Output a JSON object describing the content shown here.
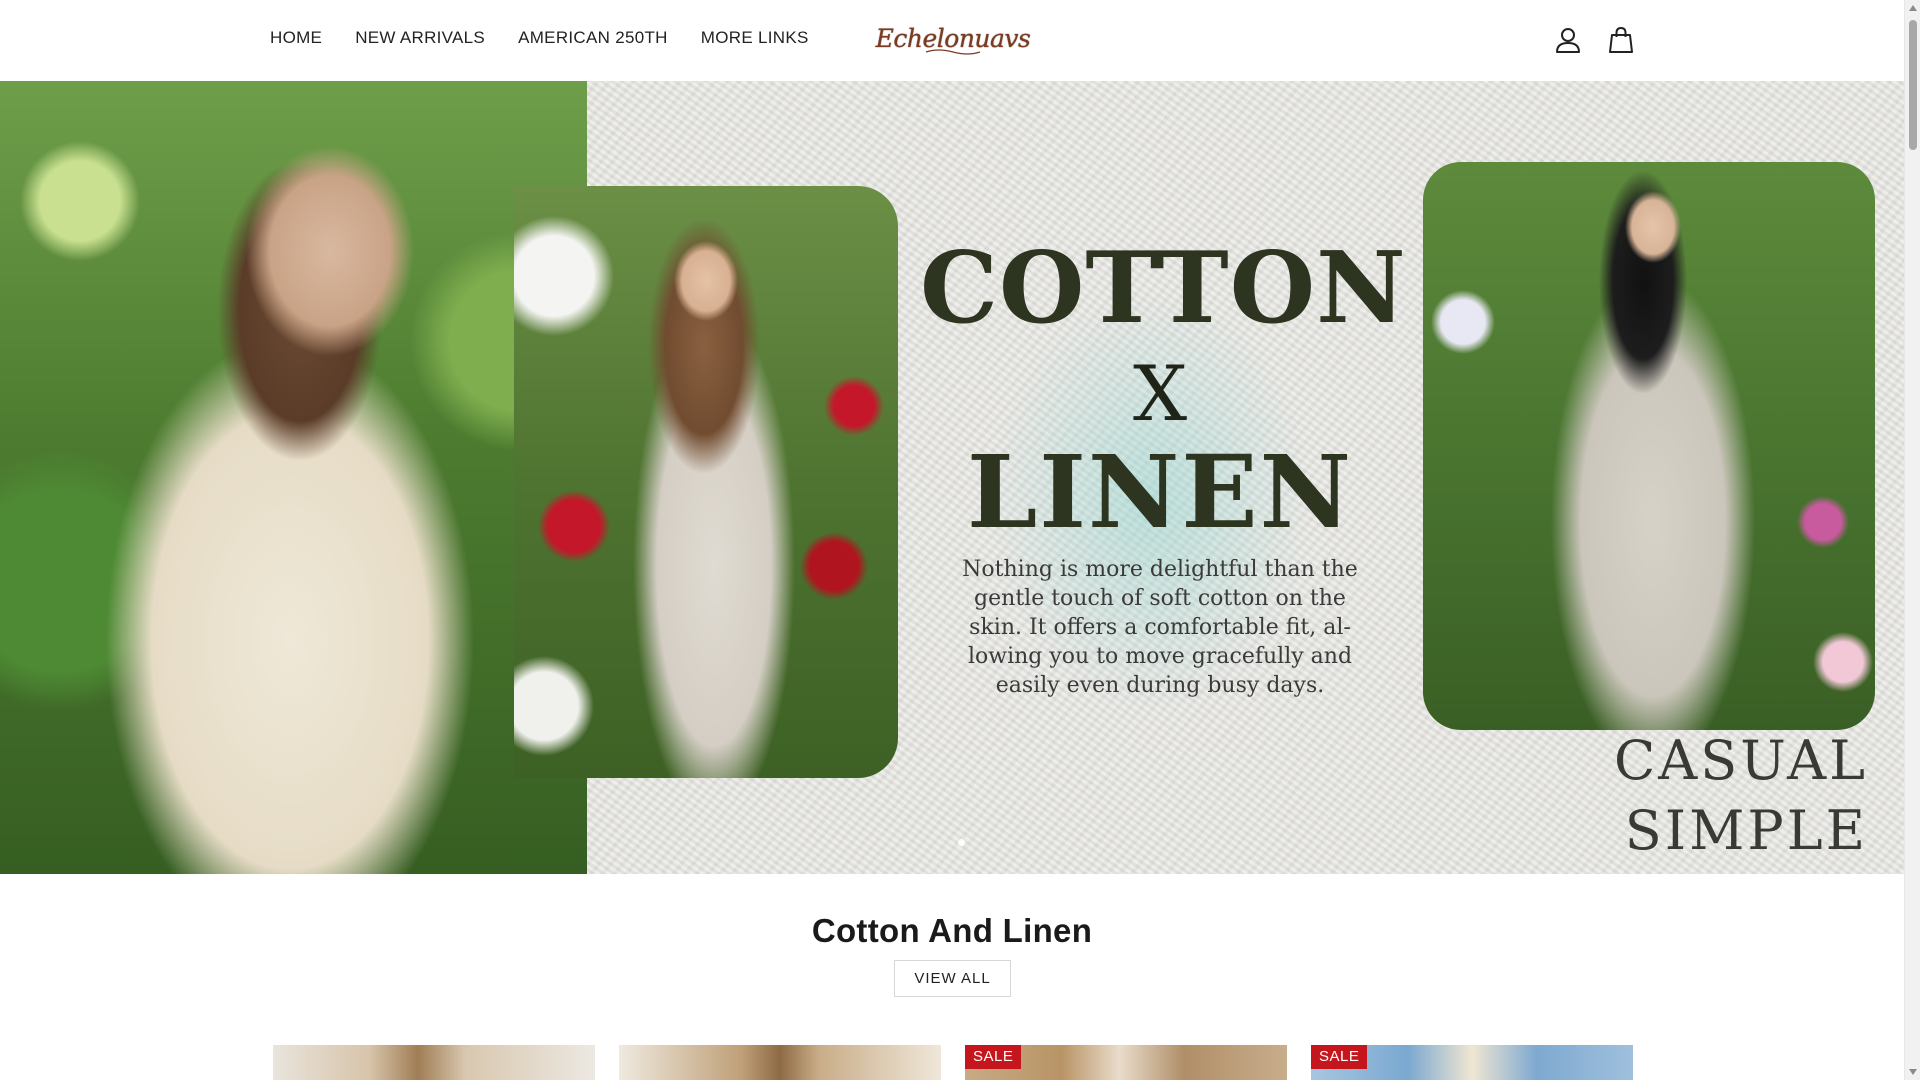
{
  "nav": {
    "items": [
      {
        "label": "HOME"
      },
      {
        "label": "NEW ARRIVALS"
      },
      {
        "label": "AMERICAN 250TH"
      },
      {
        "label": "MORE LINKS"
      }
    ],
    "logo_text": "Echelonuavs"
  },
  "header_icons": {
    "account": "user-icon",
    "cart": "shopping-bag-icon"
  },
  "hero": {
    "title_line1": "COTTON",
    "title_line2": "X",
    "title_line3": "LINEN",
    "body": "Nothing is more delightful than the gentle touch of soft cotton on the skin. It offers a comfortable fit, al-lowing you to move gracefully and easily even during busy days.",
    "tagline_line1": "CASUAL",
    "tagline_line2": "SIMPLE STYLE"
  },
  "section": {
    "title": "Cotton And Linen",
    "view_all_label": "VIEW ALL"
  },
  "products": [
    {
      "badge": ""
    },
    {
      "badge": ""
    },
    {
      "badge": "SALE"
    },
    {
      "badge": "SALE"
    }
  ],
  "colors": {
    "sale_badge": "#c4161c",
    "hero_title": "#2d3520",
    "logo": "#7a3b22"
  }
}
